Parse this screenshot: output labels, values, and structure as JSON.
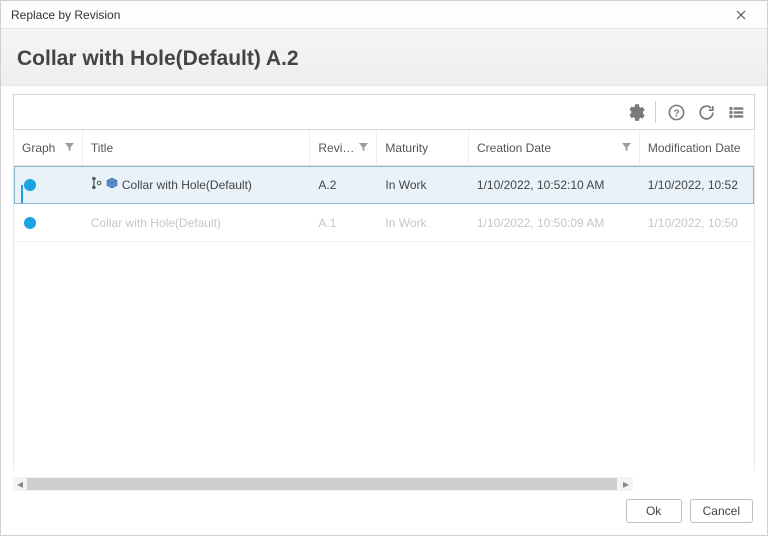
{
  "window": {
    "title": "Replace by Revision"
  },
  "header": {
    "title": "Collar with Hole(Default) A.2"
  },
  "columns": {
    "graph": "Graph",
    "title": "Title",
    "revision": "Revi…",
    "maturity": "Maturity",
    "creation": "Creation Date",
    "modification": "Modification Date"
  },
  "rows": [
    {
      "title": "Collar with Hole(Default)",
      "revision": "A.2",
      "maturity": "In Work",
      "creation": "1/10/2022, 10:52:10 AM",
      "modification": "1/10/2022, 10:52",
      "selected": true
    },
    {
      "title": "Collar with Hole(Default)",
      "revision": "A.1",
      "maturity": "In Work",
      "creation": "1/10/2022, 10:50:09 AM",
      "modification": "1/10/2022, 10:50",
      "selected": false
    }
  ],
  "footer": {
    "ok": "Ok",
    "cancel": "Cancel"
  }
}
